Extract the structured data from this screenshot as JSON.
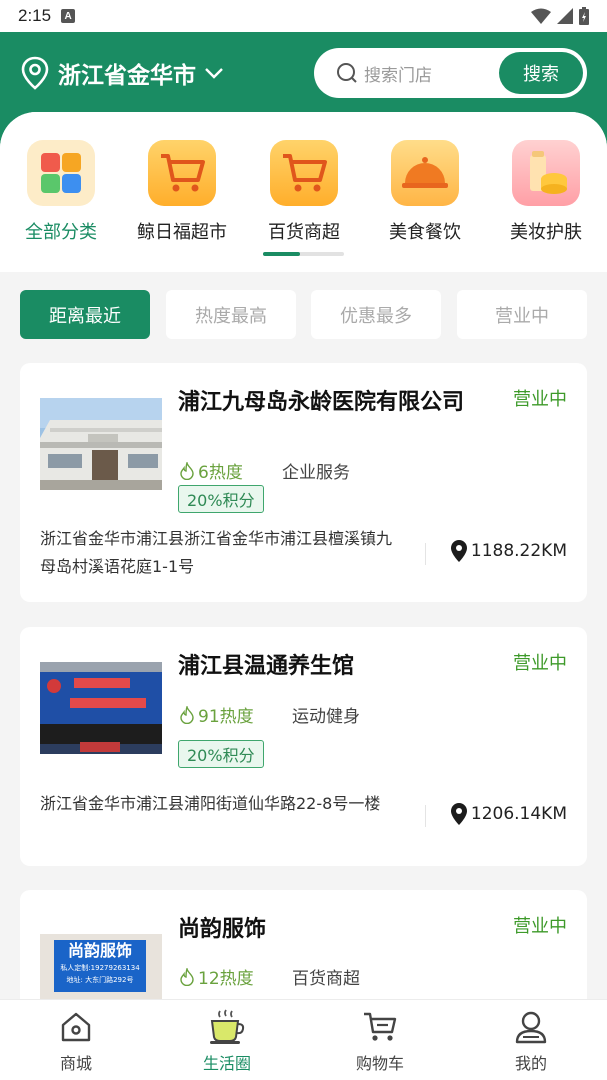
{
  "status_bar": {
    "time": "2:15",
    "badge": "A"
  },
  "header": {
    "location": "浙江省金华市",
    "search_placeholder": "搜索门店",
    "search_button": "搜索"
  },
  "categories": [
    {
      "label": "全部分类",
      "icon": "grid-icon",
      "active": true
    },
    {
      "label": "鲸日福超市",
      "icon": "cart-icon"
    },
    {
      "label": "百货商超",
      "icon": "cart-icon"
    },
    {
      "label": "美食餐饮",
      "icon": "food-cloche-icon"
    },
    {
      "label": "美妆护肤",
      "icon": "cosmetics-icon"
    }
  ],
  "filters": [
    {
      "label": "距离最近",
      "active": true
    },
    {
      "label": "热度最高"
    },
    {
      "label": "优惠最多"
    },
    {
      "label": "营业中"
    }
  ],
  "stores": [
    {
      "name": "浦江九母岛永龄医院有限公司",
      "status": "营业中",
      "heat": "6热度",
      "category": "企业服务",
      "points": "20%积分",
      "address": "浙江省金华市浦江县浙江省金华市浦江县檀溪镇九母岛村溪语花庭1-1号",
      "distance": "1188.22KM"
    },
    {
      "name": "浦江县温通养生馆",
      "status": "营业中",
      "heat": "91热度",
      "category": "运动健身",
      "points": "20%积分",
      "address": "浙江省金华市浦江县浦阳街道仙华路22-8号一楼",
      "distance": "1206.14KM"
    },
    {
      "name": "尚韵服饰",
      "status": "营业中",
      "heat": "12热度",
      "category": "百货商超",
      "sign": {
        "title": "尚韵服饰",
        "line1": "私人定制:19279263134",
        "line2": "地址: 大东门路292号"
      }
    }
  ],
  "tabs": [
    {
      "label": "商城",
      "icon": "home-icon"
    },
    {
      "label": "生活圈",
      "icon": "coffee-cup-icon",
      "active": true
    },
    {
      "label": "购物车",
      "icon": "cart-icon"
    },
    {
      "label": "我的",
      "icon": "user-icon"
    }
  ],
  "colors": {
    "primary": "#1a8c63",
    "status_green": "#3e9a2a",
    "heat_green": "#6aa23e"
  }
}
